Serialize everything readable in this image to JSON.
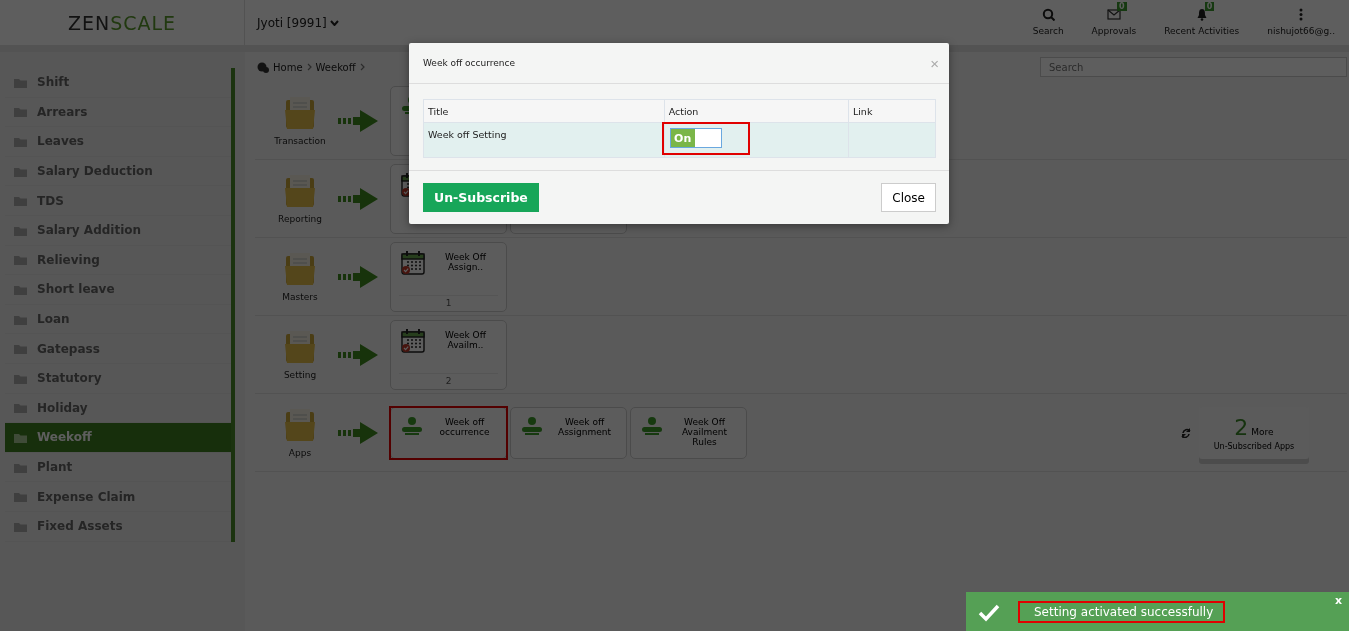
{
  "header": {
    "logo_dark": "ZEN",
    "logo_green": "SCALE",
    "user": "Jyoti [9991]",
    "actions": [
      {
        "label": "Search",
        "kind": "search"
      },
      {
        "label": "Approvals",
        "kind": "mail",
        "badge": "0"
      },
      {
        "label": "Recent Activities",
        "kind": "bell",
        "badge": "0"
      },
      {
        "label": "nishujot66@g..",
        "kind": "more"
      }
    ]
  },
  "sidebar": {
    "items": [
      {
        "label": "Shift",
        "selected": false
      },
      {
        "label": "Arrears",
        "selected": false
      },
      {
        "label": "Leaves",
        "selected": false
      },
      {
        "label": "Salary Deduction",
        "selected": false
      },
      {
        "label": "TDS",
        "selected": false
      },
      {
        "label": "Salary Addition",
        "selected": false
      },
      {
        "label": "Relieving",
        "selected": false
      },
      {
        "label": "Short leave",
        "selected": false
      },
      {
        "label": "Loan",
        "selected": false
      },
      {
        "label": "Gatepass",
        "selected": false
      },
      {
        "label": "Statutory",
        "selected": false
      },
      {
        "label": "Holiday",
        "selected": false
      },
      {
        "label": "Weekoff",
        "selected": true
      },
      {
        "label": "Plant",
        "selected": false
      },
      {
        "label": "Expense Claim",
        "selected": false
      },
      {
        "label": "Fixed Assets",
        "selected": false
      }
    ]
  },
  "breadcrumb": [
    "Home",
    "Weekoff"
  ],
  "search": {
    "placeholder": "Search"
  },
  "sections": [
    {
      "label": "Transaction",
      "apps": [
        {
          "kind": "person"
        }
      ]
    },
    {
      "label": "Reporting",
      "apps": [
        {
          "kind": "calendar"
        },
        {
          "kind": "blank"
        }
      ]
    },
    {
      "label": "Masters",
      "apps": [
        {
          "kind": "calendar",
          "title": "Week Off Assign..",
          "count": "1"
        }
      ]
    },
    {
      "label": "Setting",
      "apps": [
        {
          "kind": "calendar",
          "title": "Week Off Availm..",
          "count": "2"
        }
      ]
    },
    {
      "label": "Apps",
      "apps": [
        {
          "kind": "person",
          "title": "Week off occurrence",
          "highlighted": true
        },
        {
          "kind": "person",
          "title": "Week off Assignment"
        },
        {
          "kind": "person",
          "title": "Week Off Availment Rules"
        }
      ],
      "more": {
        "count": "2",
        "label": "More",
        "caption": "Un-Subscribed Apps"
      }
    }
  ],
  "modal": {
    "title": "Week off occurrence",
    "close": "×",
    "columns": [
      "Title",
      "Action",
      "Link"
    ],
    "rows": [
      {
        "title": "Week off Setting",
        "on": true,
        "toggle_label": "On",
        "highlighted": true
      }
    ],
    "primary_button": "Un-Subscribe",
    "secondary_button": "Close"
  },
  "toast": {
    "message": "Setting activated successfully",
    "close": "x",
    "highlighted": true
  }
}
